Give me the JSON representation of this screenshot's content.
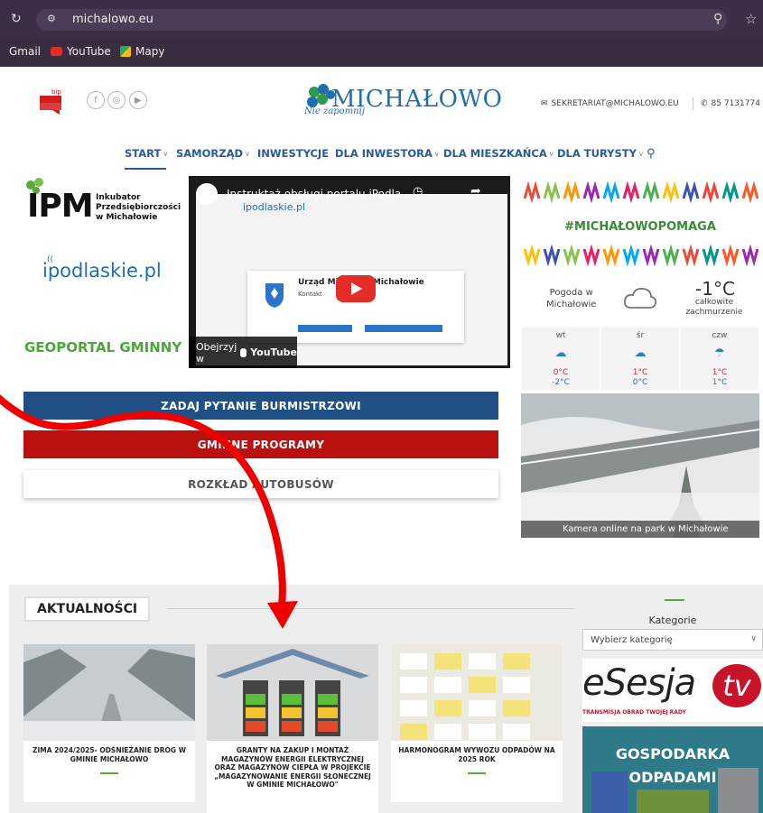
{
  "browser": {
    "url": "michalowo.eu",
    "bookmarks": [
      "Gmail",
      "YouTube",
      "Mapy"
    ]
  },
  "header": {
    "bip_label": "bip",
    "logo_text": "MICHAŁOWO",
    "logo_tagline": "Nie zapomnij",
    "email": "SEKRETARIAT@MICHALOWO.EU",
    "phone": "85 7131774"
  },
  "nav": {
    "items": [
      {
        "label": "START",
        "dropdown": true
      },
      {
        "label": "SAMORZĄD",
        "dropdown": true
      },
      {
        "label": "INWESTYCJE",
        "dropdown": false
      },
      {
        "label": "DLA INWESTORA",
        "dropdown": true
      },
      {
        "label": "DLA MIESZKAŃCA",
        "dropdown": true
      },
      {
        "label": "DLA TURYSTY",
        "dropdown": true
      }
    ]
  },
  "left": {
    "ipm_big": "IPM",
    "ipm_small_1": "Inkubator",
    "ipm_small_2": "Przedsiębiorczości",
    "ipm_small_3": "w Michałowie",
    "ipodlaskie": "ipodlaskie.pl",
    "geoportal": "GEOPORTAL GMINNY"
  },
  "video": {
    "title": "Instruktaż obsługi portalu iPodla...",
    "watch_label": "Obejrzyj w",
    "yt_label": "YouTube",
    "inner_brand": "ipodlaskie.pl",
    "inner_heading": "Urząd Miejski w Michałowie",
    "inner_sub": "Kontakt"
  },
  "buttons": {
    "ask": "ZADAJ PYTANIE BURMISTRZOWI",
    "programs": "GMINNE PROGRAMY",
    "bus": "ROZKŁAD AUTOBUSÓW"
  },
  "right": {
    "help_tag": "#MICHAŁOWOPOMAGA",
    "weather_label_1": "Pogoda w",
    "weather_label_2": "Michałowie",
    "weather_temp": "-1°C",
    "weather_desc_1": "całkowite",
    "weather_desc_2": "zachmurzenie",
    "forecast": [
      {
        "day": "wt",
        "hi": "0°C",
        "lo": "-2°C"
      },
      {
        "day": "śr",
        "hi": "1°C",
        "lo": "0°C"
      },
      {
        "day": "czw",
        "hi": "1°C",
        "lo": "1°C"
      }
    ],
    "camera_caption": "Kamera online na park w Michałowie"
  },
  "news": {
    "title": "AKTUALNOŚCI",
    "cards": [
      {
        "text": "ZIMA 2024/2025- ODŚNIEŻANIE DRÓG W GMINIE MICHAŁOWO"
      },
      {
        "text": "GRANTY NA ZAKUP I MONTAŻ MAGAZYNÓW ENERGII ELEKTRYCZNEJ ORAZ MAGAZYNÓW CIEPŁA W PROJEKCIE „MAGAZYNOWANIE ENERGII SŁONECZNEJ W GMINIE MICHAŁOWO\""
      },
      {
        "text": "HARMONOGRAM WYWOZU ODPADÓW NA 2025 ROK"
      }
    ]
  },
  "sidebar": {
    "categories_label": "Kategorie",
    "categories_placeholder": "Wybierz kategorię",
    "esesja": "eSesja",
    "esesja_tv": "tv",
    "esesja_sub": "TRANSMISJA OBRAD TWOJEJ RADY",
    "gosp_1": "GOSPODARKA",
    "gosp_2": "ODPADAMI"
  },
  "colors": {
    "brand_blue": "#1f4f85",
    "brand_red": "#bb1010",
    "accent_green": "#5aa83a",
    "annotation_red": "#ee0000"
  }
}
